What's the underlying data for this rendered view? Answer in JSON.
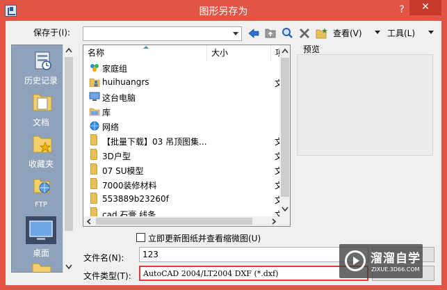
{
  "window": {
    "title": "图形另存为",
    "help_label": "?",
    "close_label": "✕"
  },
  "toolbar": {
    "save_in_label": "保存于(I):",
    "save_in_value": "",
    "view_label": "查看(V)",
    "tools_label": "工具(L)"
  },
  "places": [
    {
      "label": "历史记录",
      "icon": "history-icon"
    },
    {
      "label": "文档",
      "icon": "documents-icon"
    },
    {
      "label": "收藏夹",
      "icon": "favorites-icon"
    },
    {
      "label": "FTP",
      "icon": "ftp-icon"
    },
    {
      "label": "桌面",
      "icon": "desktop-icon"
    }
  ],
  "filelist": {
    "columns": {
      "name": "名称",
      "size": "大小",
      "type": "项"
    },
    "rows": [
      {
        "name": "家庭组",
        "type": "",
        "icon": "homegroup-icon"
      },
      {
        "name": "huihuangrs",
        "type": "文",
        "icon": "user-folder-icon"
      },
      {
        "name": "这台电脑",
        "type": "",
        "icon": "computer-icon"
      },
      {
        "name": "库",
        "type": "",
        "icon": "library-icon"
      },
      {
        "name": "网络",
        "type": "",
        "icon": "network-icon"
      },
      {
        "name": "【批量下载】03 吊顶图集...",
        "type": "文",
        "icon": "folder-icon"
      },
      {
        "name": "3D户型",
        "type": "文",
        "icon": "folder-icon"
      },
      {
        "name": "07 SU模型",
        "type": "文",
        "icon": "folder-icon"
      },
      {
        "name": "7000装修材料",
        "type": "文",
        "icon": "folder-icon"
      },
      {
        "name": "553889b23260f",
        "type": "文",
        "icon": "folder-icon"
      },
      {
        "name": "cad 石膏 线条",
        "type": "文",
        "icon": "folder-icon"
      }
    ]
  },
  "preview": {
    "label": "预览"
  },
  "options": {
    "update_thumbnail_label": "立即更新图纸并查看缩微图(U)"
  },
  "filename": {
    "label": "文件名(N):",
    "value": "123"
  },
  "filetype": {
    "label": "文件类型(T):",
    "value": "AutoCAD 2004/LT2004 DXF (*.dxf)"
  },
  "watermark": {
    "name": "溜溜自学",
    "url": "ZIXUE.3D66.COM"
  },
  "colors": {
    "titlebar": "#e25545",
    "close_button": "#c7392b",
    "places_bg": "#8ea3bb",
    "highlight_border": "#e53935"
  }
}
